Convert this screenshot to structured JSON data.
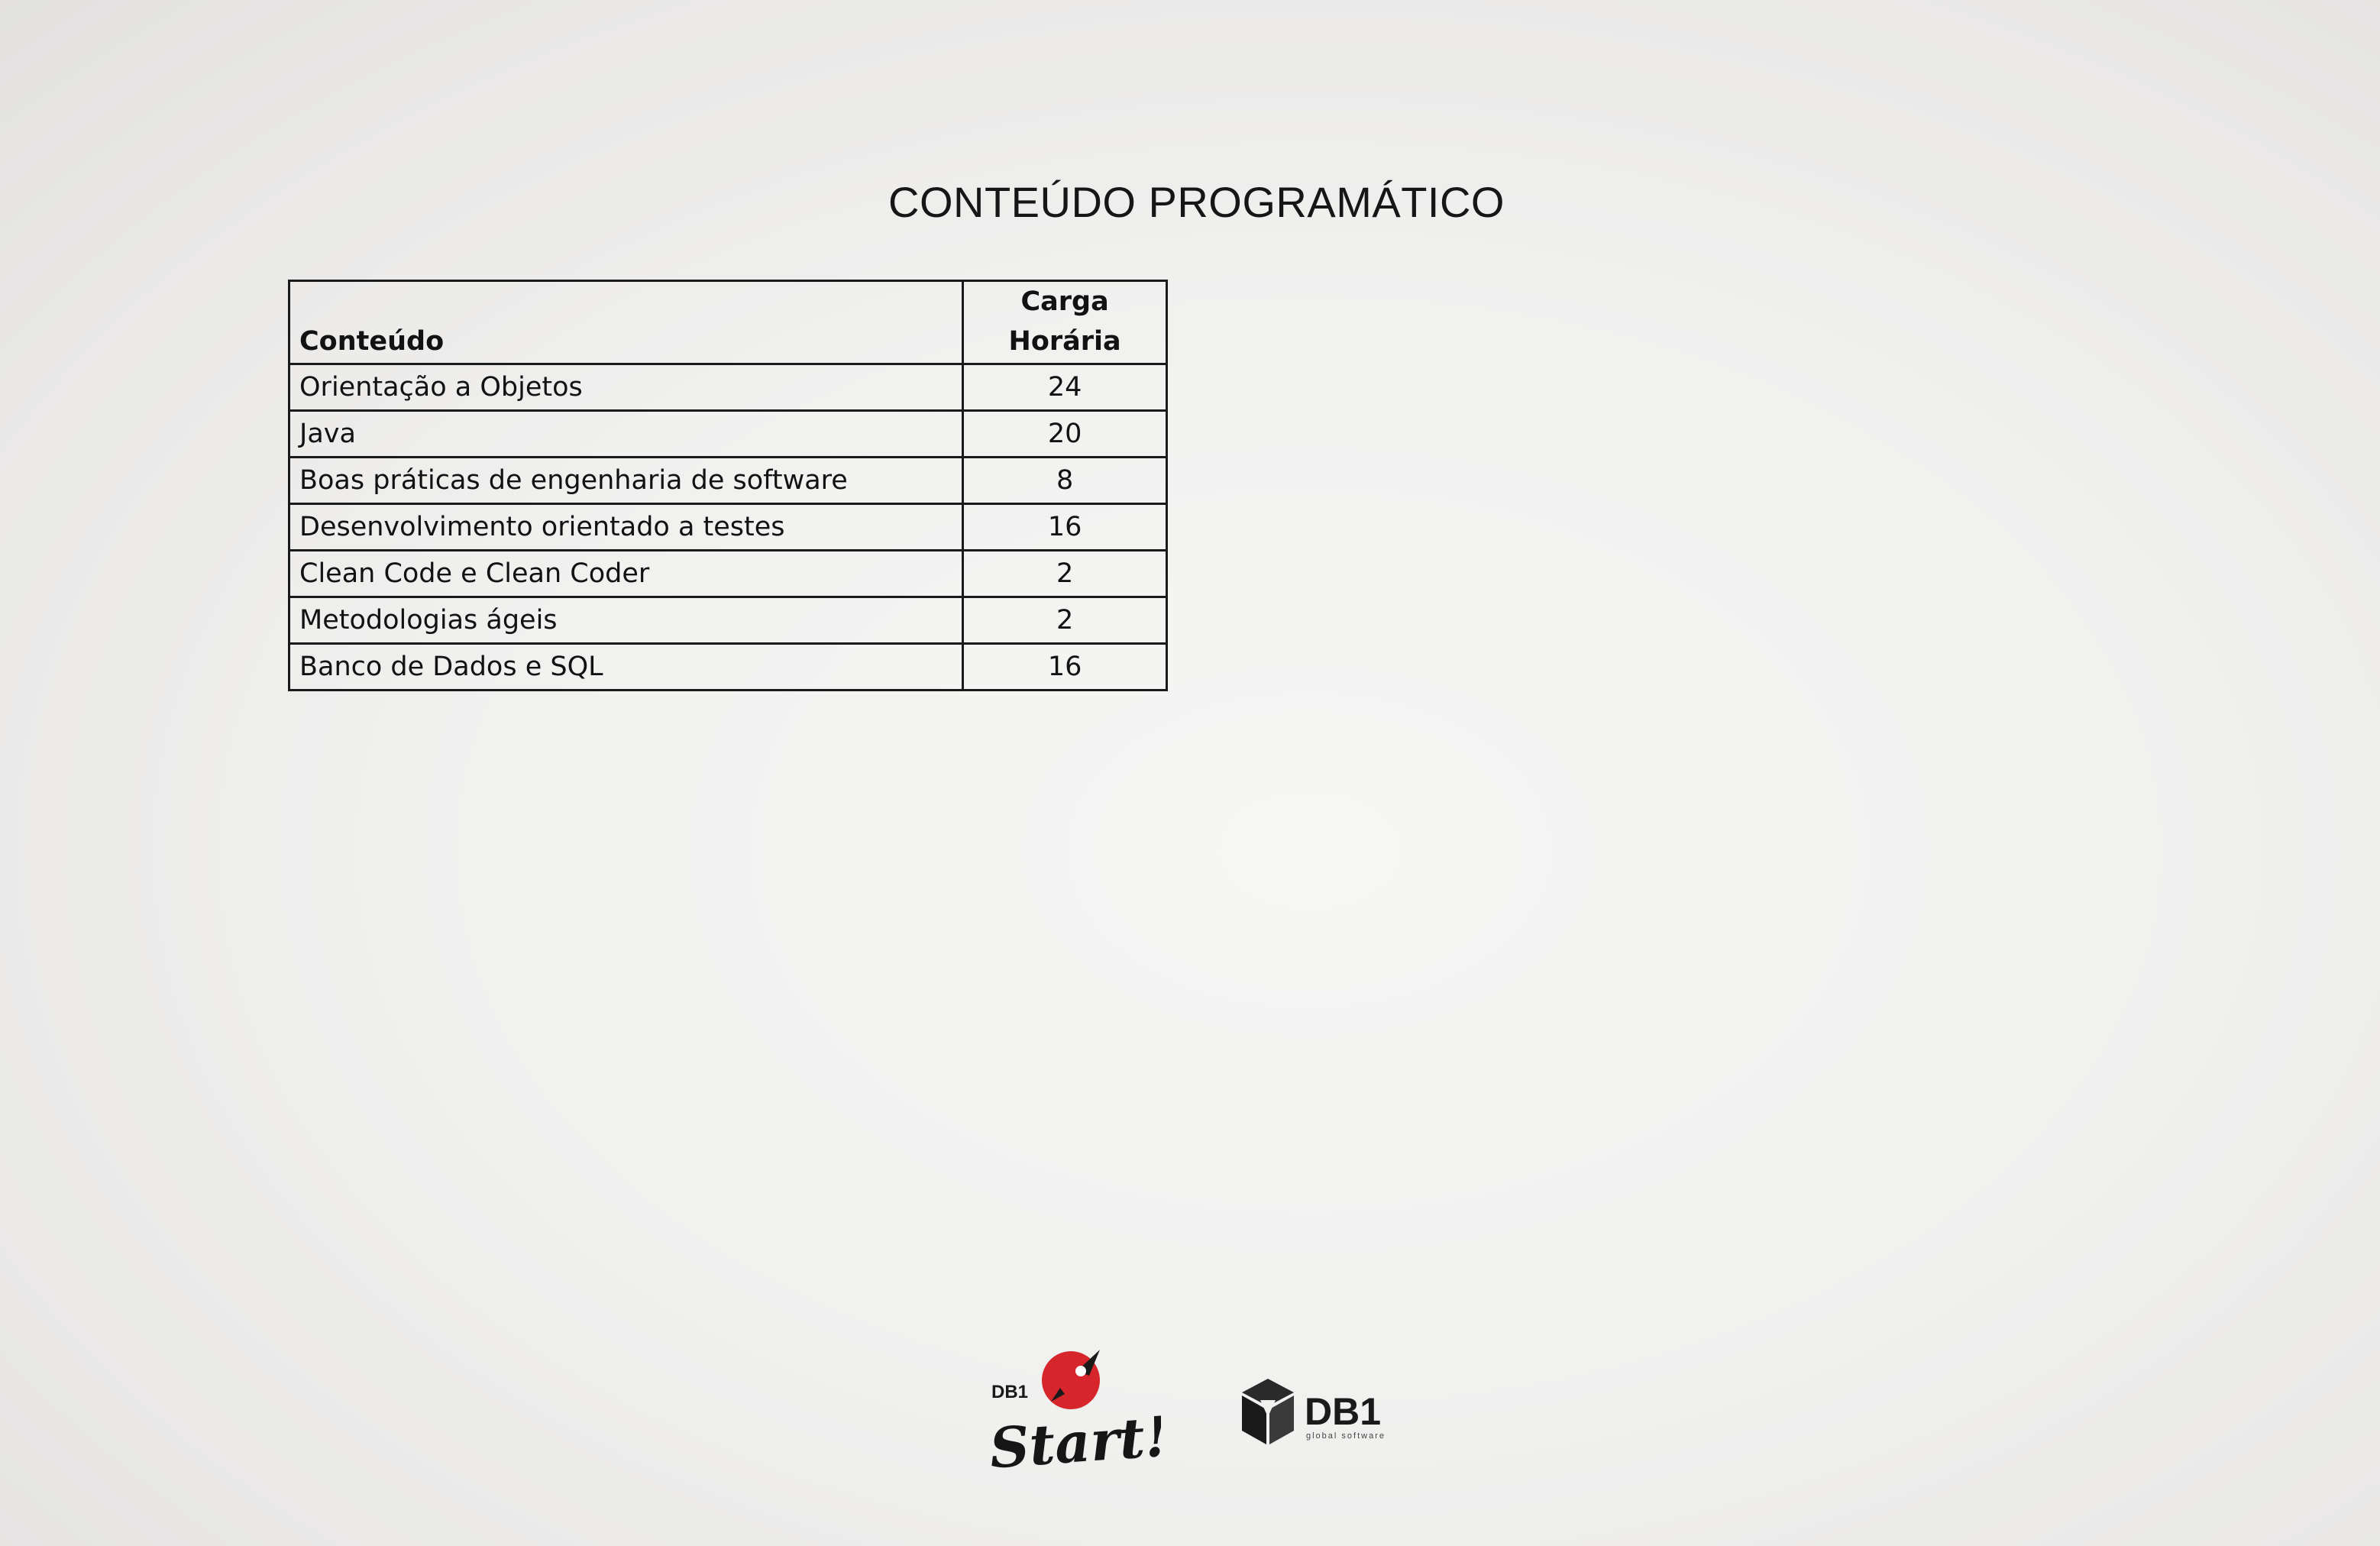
{
  "document": {
    "title": "CONTEÚDO PROGRAMÁTICO"
  },
  "table": {
    "headers": {
      "content": "Conteúdo",
      "hours_line1": "Carga",
      "hours_line2": "Horária"
    },
    "rows": [
      {
        "content": "Orientação a Objetos",
        "hours": "24"
      },
      {
        "content": "Java",
        "hours": "20"
      },
      {
        "content": "Boas práticas de engenharia de software",
        "hours": "8"
      },
      {
        "content": "Desenvolvimento orientado a testes",
        "hours": "16"
      },
      {
        "content": "Clean Code e Clean Coder",
        "hours": "2"
      },
      {
        "content": "Metodologias ágeis",
        "hours": "2"
      },
      {
        "content": "Banco de Dados e SQL",
        "hours": "16"
      }
    ]
  },
  "footer": {
    "logo_start": {
      "brand": "DB1",
      "word": "Start!",
      "accent_color": "#d6262b",
      "icon": "rocket-icon"
    },
    "logo_db1": {
      "brand": "DB1",
      "tagline": "global software",
      "icon": "cube-icon"
    }
  }
}
